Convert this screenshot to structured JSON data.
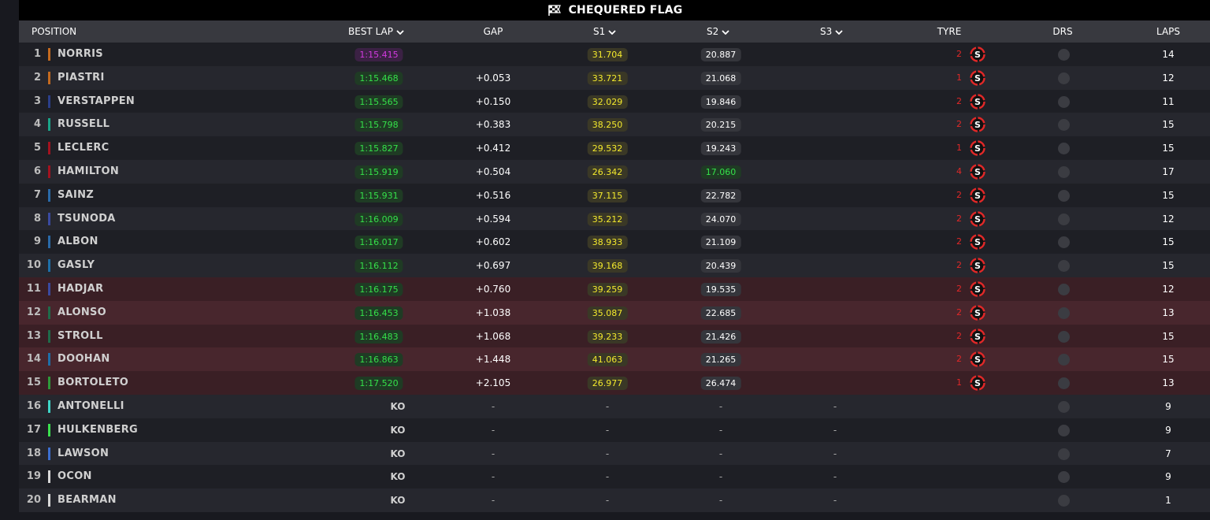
{
  "banner": {
    "title": "CHEQUERED FLAG",
    "icon": "chequered-flag-icon"
  },
  "columns": {
    "position": "POSITION",
    "best_lap": "BEST LAP",
    "gap": "GAP",
    "s1": "S1",
    "s2": "S2",
    "s3": "S3",
    "tyre": "TYRE",
    "drs": "DRS",
    "laps": "LAPS"
  },
  "colors": {
    "purple_time": "#d33ae0",
    "green_time": "#35e04a",
    "yellow_sector": "#f4ea2d",
    "tyre_soft": "#e02828",
    "eliminated_row": "#3a1f25"
  },
  "drivers": [
    {
      "pos": "1",
      "name": "NORRIS",
      "team_color": "#c46a1f",
      "best": "1:15.415",
      "best_purple": true,
      "gap": "",
      "s1": "31.704",
      "s2": "20.887",
      "s3": "",
      "tyre_laps": "2",
      "tyre": "S",
      "drs": "",
      "laps": "14",
      "eliminated": false
    },
    {
      "pos": "2",
      "name": "PIASTRI",
      "team_color": "#c46a1f",
      "best": "1:15.468",
      "gap": "+0.053",
      "s1": "33.721",
      "s2": "21.068",
      "s3": "",
      "tyre_laps": "1",
      "tyre": "S",
      "drs": "",
      "laps": "12",
      "eliminated": false
    },
    {
      "pos": "3",
      "name": "VERSTAPPEN",
      "team_color": "#2b3f8a",
      "best": "1:15.565",
      "gap": "+0.150",
      "s1": "32.029",
      "s2": "19.846",
      "s3": "",
      "tyre_laps": "2",
      "tyre": "S",
      "drs": "",
      "laps": "11",
      "eliminated": false
    },
    {
      "pos": "4",
      "name": "RUSSELL",
      "team_color": "#1aa589",
      "best": "1:15.798",
      "gap": "+0.383",
      "s1": "38.250",
      "s2": "20.215",
      "s3": "",
      "tyre_laps": "2",
      "tyre": "S",
      "drs": "",
      "laps": "15",
      "eliminated": false
    },
    {
      "pos": "5",
      "name": "LECLERC",
      "team_color": "#a3121f",
      "best": "1:15.827",
      "gap": "+0.412",
      "s1": "29.532",
      "s2": "19.243",
      "s3": "",
      "tyre_laps": "1",
      "tyre": "S",
      "drs": "",
      "laps": "15",
      "eliminated": false
    },
    {
      "pos": "6",
      "name": "HAMILTON",
      "team_color": "#a3121f",
      "best": "1:15.919",
      "gap": "+0.504",
      "s1": "26.342",
      "s2": "17.060",
      "s2_green": true,
      "s3": "",
      "tyre_laps": "4",
      "tyre": "S",
      "drs": "",
      "laps": "17",
      "eliminated": false
    },
    {
      "pos": "7",
      "name": "SAINZ",
      "team_color": "#2a6aa8",
      "best": "1:15.931",
      "gap": "+0.516",
      "s1": "37.115",
      "s2": "22.782",
      "s3": "",
      "tyre_laps": "2",
      "tyre": "S",
      "drs": "",
      "laps": "15",
      "eliminated": false
    },
    {
      "pos": "8",
      "name": "TSUNODA",
      "team_color": "#3a4aa0",
      "best": "1:16.009",
      "gap": "+0.594",
      "s1": "35.212",
      "s2": "24.070",
      "s3": "",
      "tyre_laps": "2",
      "tyre": "S",
      "drs": "",
      "laps": "12",
      "eliminated": false
    },
    {
      "pos": "9",
      "name": "ALBON",
      "team_color": "#2a6aa8",
      "best": "1:16.017",
      "gap": "+0.602",
      "s1": "38.933",
      "s2": "21.109",
      "s3": "",
      "tyre_laps": "2",
      "tyre": "S",
      "drs": "",
      "laps": "15",
      "eliminated": false
    },
    {
      "pos": "10",
      "name": "GASLY",
      "team_color": "#1e6fa8",
      "best": "1:16.112",
      "gap": "+0.697",
      "s1": "39.168",
      "s2": "20.439",
      "s3": "",
      "tyre_laps": "2",
      "tyre": "S",
      "drs": "",
      "laps": "15",
      "eliminated": false
    },
    {
      "pos": "11",
      "name": "HADJAR",
      "team_color": "#3a4aa0",
      "best": "1:16.175",
      "gap": "+0.760",
      "s1": "39.259",
      "s2": "19.535",
      "s3": "",
      "tyre_laps": "2",
      "tyre": "S",
      "drs": "",
      "laps": "12",
      "eliminated": true
    },
    {
      "pos": "12",
      "name": "ALONSO",
      "team_color": "#1f6b4a",
      "best": "1:16.453",
      "gap": "+1.038",
      "s1": "35.087",
      "s2": "22.685",
      "s3": "",
      "tyre_laps": "2",
      "tyre": "S",
      "drs": "",
      "laps": "13",
      "eliminated": true
    },
    {
      "pos": "13",
      "name": "STROLL",
      "team_color": "#1f6b4a",
      "best": "1:16.483",
      "gap": "+1.068",
      "s1": "39.233",
      "s2": "21.426",
      "s3": "",
      "tyre_laps": "2",
      "tyre": "S",
      "drs": "",
      "laps": "15",
      "eliminated": true
    },
    {
      "pos": "14",
      "name": "DOOHAN",
      "team_color": "#1e6fa8",
      "best": "1:16.863",
      "gap": "+1.448",
      "s1": "41.063",
      "s2": "21.265",
      "s3": "",
      "tyre_laps": "2",
      "tyre": "S",
      "drs": "",
      "laps": "15",
      "eliminated": true
    },
    {
      "pos": "15",
      "name": "BORTOLETO",
      "team_color": "#2e9a3a",
      "best": "1:17.520",
      "gap": "+2.105",
      "s1": "26.977",
      "s2": "26.474",
      "s3": "",
      "tyre_laps": "1",
      "tyre": "S",
      "drs": "",
      "laps": "13",
      "eliminated": true
    },
    {
      "pos": "16",
      "name": "ANTONELLI",
      "team_color": "#3fd6c8",
      "best": "KO",
      "gap": "-",
      "s1": "-",
      "s2": "-",
      "s3": "-",
      "tyre_laps": "",
      "tyre": "",
      "drs": "",
      "laps": "9",
      "eliminated": false
    },
    {
      "pos": "17",
      "name": "HULKENBERG",
      "team_color": "#3be04e",
      "best": "KO",
      "gap": "-",
      "s1": "-",
      "s2": "-",
      "s3": "-",
      "tyre_laps": "",
      "tyre": "",
      "drs": "",
      "laps": "9",
      "eliminated": false
    },
    {
      "pos": "18",
      "name": "LAWSON",
      "team_color": "#3c6fd0",
      "best": "KO",
      "gap": "-",
      "s1": "-",
      "s2": "-",
      "s3": "-",
      "tyre_laps": "",
      "tyre": "",
      "drs": "",
      "laps": "7",
      "eliminated": false
    },
    {
      "pos": "19",
      "name": "OCON",
      "team_color": "#d8d8d8",
      "best": "KO",
      "gap": "-",
      "s1": "-",
      "s2": "-",
      "s3": "-",
      "tyre_laps": "",
      "tyre": "",
      "drs": "",
      "laps": "9",
      "eliminated": false
    },
    {
      "pos": "20",
      "name": "BEARMAN",
      "team_color": "#d8d8d8",
      "best": "KO",
      "gap": "-",
      "s1": "-",
      "s2": "-",
      "s3": "-",
      "tyre_laps": "",
      "tyre": "",
      "drs": "",
      "laps": "1",
      "eliminated": false
    }
  ]
}
